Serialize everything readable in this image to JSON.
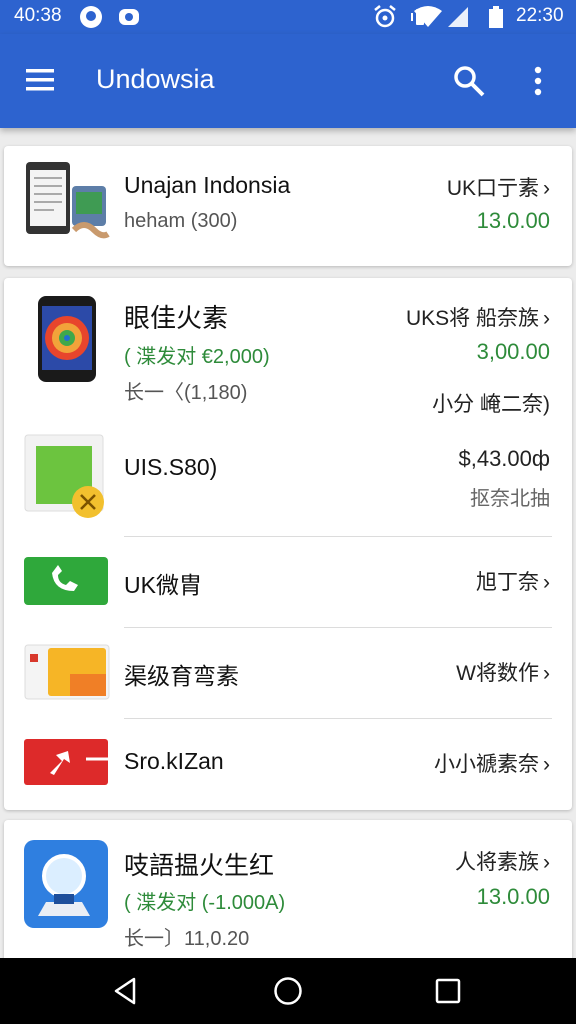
{
  "status_bar": {
    "time_left": "40:38",
    "time_right": "22:30"
  },
  "app_bar": {
    "title": "Undowsia",
    "icons": [
      "menu-icon",
      "search-icon",
      "more-vert-icon"
    ]
  },
  "card1": {
    "name": "Unajan Indonsia",
    "sub": "heham (300)",
    "right_label": "UK口亍素",
    "right_value": "13.0.00"
  },
  "card2": {
    "row1": {
      "name": "眼佳火素",
      "sub_green": "( 渫发对 €2,000)",
      "sub_gray": "长一〈(1,180)",
      "right_label": "UKS将 船奈族",
      "right_value": "3,00.00",
      "right_extra": "小分 崦二奈)"
    },
    "row2": {
      "name": "UIS.S80)",
      "right_value": "$,43.00ф",
      "right_sub": "抠奈北抽"
    },
    "row3": {
      "name": "UK微胄",
      "right_label": "旭丁奈"
    },
    "row4": {
      "name": "渠级育弯素",
      "right_label": "W将数作"
    },
    "row5": {
      "name": "Sro.kIZan",
      "right_label": "小小禠素奈"
    }
  },
  "card3": {
    "name": "吱語揾火生红",
    "sub_green": "( 渫发对 (-1.000A)",
    "sub_gray": "长一〕11,0.20",
    "right_label": "人将素族",
    "right_value": "13.0.00"
  },
  "nav_bar": {
    "icons": [
      "back-icon",
      "home-icon",
      "recents-icon"
    ]
  },
  "colors": {
    "primary": "#2d63cf",
    "green_value": "#2e8b3a"
  }
}
